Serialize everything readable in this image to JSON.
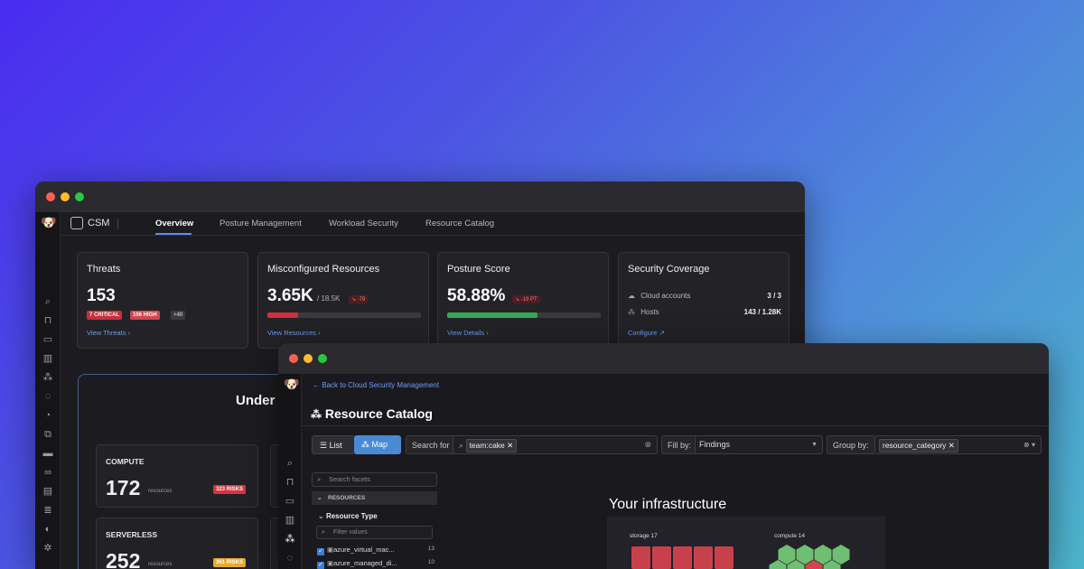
{
  "back_window": {
    "app_name": "CSM",
    "tabs": [
      {
        "label": "Overview",
        "active": true
      },
      {
        "label": "Posture Management",
        "active": false
      },
      {
        "label": "Workload Security",
        "active": false
      },
      {
        "label": "Resource Catalog",
        "active": false
      }
    ],
    "cards": {
      "threats": {
        "title": "Threats",
        "value": "153",
        "badges": [
          {
            "label": "7 CRITICAL",
            "color": "#c6303b"
          },
          {
            "label": "106 HIGH",
            "color": "#d2464e"
          },
          {
            "label": "+40",
            "color": "#3a3a40"
          }
        ],
        "link": "View Threats"
      },
      "misconfigured": {
        "title": "Misconfigured Resources",
        "value": "3.65K",
        "total": "/ 18.5K",
        "delta": "↘ -79",
        "progress": 0.2,
        "bar_color": "#d0313e",
        "link": "View Resources"
      },
      "posture": {
        "title": "Posture Score",
        "value": "58.88%",
        "delta": "↘ -19 PT",
        "progress": 0.59,
        "bar_color": "#3aa856",
        "link": "View Details"
      },
      "coverage": {
        "title": "Security Coverage",
        "rows": [
          {
            "icon": "cloud-icon",
            "label": "Cloud accounts",
            "value": "3 / 3"
          },
          {
            "icon": "hosts-icon",
            "label": "Hosts",
            "value": "143 / 1.28K"
          }
        ],
        "link": "Configure"
      }
    },
    "panel": {
      "title": "Under",
      "tiles": [
        {
          "label": "COMPUTE",
          "value": "172",
          "unit": "resources",
          "risk": "323 RISKS",
          "risk_color": "#d63440"
        },
        {
          "label": "SERVERLESS",
          "value": "252",
          "unit": "resources",
          "risk": "361 RISKS",
          "risk_color": "#e9a92c"
        }
      ]
    }
  },
  "front_window": {
    "back_link": "Back to Cloud Security Management",
    "title": "Resource Catalog",
    "view_toggle": {
      "list_label": "List",
      "map_label": "Map",
      "active": "Map"
    },
    "search": {
      "label": "Search for",
      "chip": "team:cake"
    },
    "fill_by": {
      "label": "Fill by:",
      "value": "Findings"
    },
    "group_by": {
      "label": "Group by:",
      "chip": "resource_category"
    },
    "facets": {
      "search_placeholder": "Search facets",
      "section": "RESOURCES",
      "group": "Resource Type",
      "filter_placeholder": "Filter values",
      "rows": [
        {
          "label": "azure_virtual_mac...",
          "count": "13",
          "checked": true
        },
        {
          "label": "azure_managed_di...",
          "count": "10",
          "checked": true
        }
      ]
    },
    "infrastructure": {
      "title": "Your infrastructure",
      "groups": [
        {
          "name": "storage",
          "count": "17"
        },
        {
          "name": "compute",
          "count": "14"
        }
      ]
    }
  }
}
